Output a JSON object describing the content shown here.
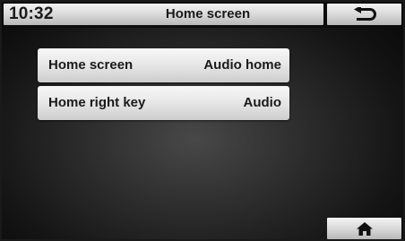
{
  "header": {
    "time": "10:32",
    "title": "Home screen",
    "back_icon": "back-arrow-icon"
  },
  "menu": {
    "items": [
      {
        "label": "Home screen",
        "value": "Audio home"
      },
      {
        "label": "Home right key",
        "value": "Audio"
      }
    ]
  },
  "footer": {
    "home_icon": "home-icon"
  },
  "colors": {
    "button_light": "#f4f4f4",
    "button_dark": "#b9b9b9",
    "text": "#1a1a1a",
    "background": "#141414"
  }
}
